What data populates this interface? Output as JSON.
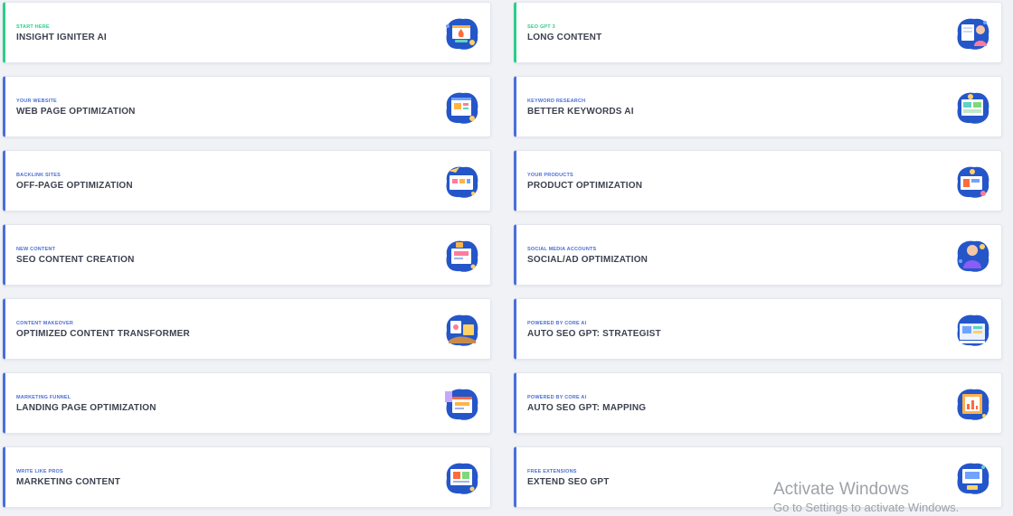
{
  "colors": {
    "accent_blue": "#4a6fd8",
    "accent_green": "#2ecc8a",
    "title_text": "#3d4250",
    "page_bg": "#f1f2f6"
  },
  "cards": [
    {
      "subtitle": "START HERE",
      "title": "INSIGHT IGNITER AI",
      "icon": "fire-illustration-icon",
      "accent": "green"
    },
    {
      "subtitle": "SEO GPT 3",
      "title": "LONG CONTENT",
      "icon": "writer-illustration-icon",
      "accent": "green"
    },
    {
      "subtitle": "YOUR WEBSITE",
      "title": "WEB PAGE OPTIMIZATION",
      "icon": "webpage-illustration-icon",
      "accent": "blue"
    },
    {
      "subtitle": "KEYWORD RESEARCH",
      "title": "BETTER KEYWORDS AI",
      "icon": "keywords-illustration-icon",
      "accent": "blue"
    },
    {
      "subtitle": "BACKLINK SITES",
      "title": "OFF-PAGE OPTIMIZATION",
      "icon": "backlink-illustration-icon",
      "accent": "blue"
    },
    {
      "subtitle": "YOUR PRODUCTS",
      "title": "PRODUCT OPTIMIZATION",
      "icon": "product-illustration-icon",
      "accent": "blue"
    },
    {
      "subtitle": "NEW CONTENT",
      "title": "SEO CONTENT CREATION",
      "icon": "content-illustration-icon",
      "accent": "blue"
    },
    {
      "subtitle": "SOCIAL MEDIA ACCOUNTS",
      "title": "SOCIAL/AD OPTIMIZATION",
      "icon": "social-illustration-icon",
      "accent": "blue"
    },
    {
      "subtitle": "CONTENT MAKEOVER",
      "title": "OPTIMIZED CONTENT TRANSFORMER",
      "icon": "transformer-illustration-icon",
      "accent": "blue"
    },
    {
      "subtitle": "POWERED BY CORE AI",
      "title": "AUTO SEO GPT: STRATEGIST",
      "icon": "strategist-illustration-icon",
      "accent": "blue"
    },
    {
      "subtitle": "MARKETING FUNNEL",
      "title": "LANDING PAGE OPTIMIZATION",
      "icon": "landing-page-illustration-icon",
      "accent": "blue"
    },
    {
      "subtitle": "POWERED BY CORE AI",
      "title": "AUTO SEO GPT: MAPPING",
      "icon": "mapping-illustration-icon",
      "accent": "blue"
    },
    {
      "subtitle": "WRITE LIKE PROS",
      "title": "MARKETING CONTENT",
      "icon": "marketing-illustration-icon",
      "accent": "blue"
    },
    {
      "subtitle": "FREE EXTENSIONS",
      "title": "EXTEND SEO GPT",
      "icon": "extension-illustration-icon",
      "accent": "blue"
    }
  ],
  "watermark": {
    "line1": "Activate Windows",
    "line2": "Go to Settings to activate Windows."
  }
}
